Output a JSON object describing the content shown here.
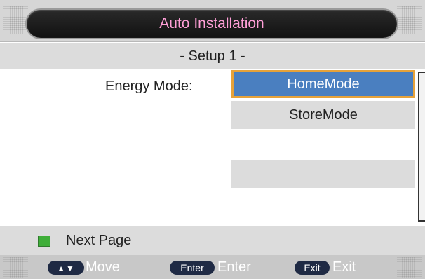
{
  "header": {
    "title": "Auto Installation"
  },
  "subtitle": "- Setup 1 -",
  "settings": {
    "energy_mode_label": "Energy Mode:",
    "options": [
      {
        "label": "HomeMode",
        "selected": true
      },
      {
        "label": "StoreMode",
        "selected": false
      },
      {
        "label": "",
        "selected": false
      }
    ]
  },
  "footer": {
    "next_page_label": "Next Page",
    "help": {
      "move_key": "▲▼",
      "move_label": "Move",
      "enter_key": "Enter",
      "enter_label": "Enter",
      "exit_key": "Exit",
      "exit_label": "Exit"
    }
  },
  "colors": {
    "title_text": "#ff9fd7",
    "selected_bg": "#4a7fc0",
    "selected_border": "#e6a23a",
    "green_key": "#3fae39"
  }
}
